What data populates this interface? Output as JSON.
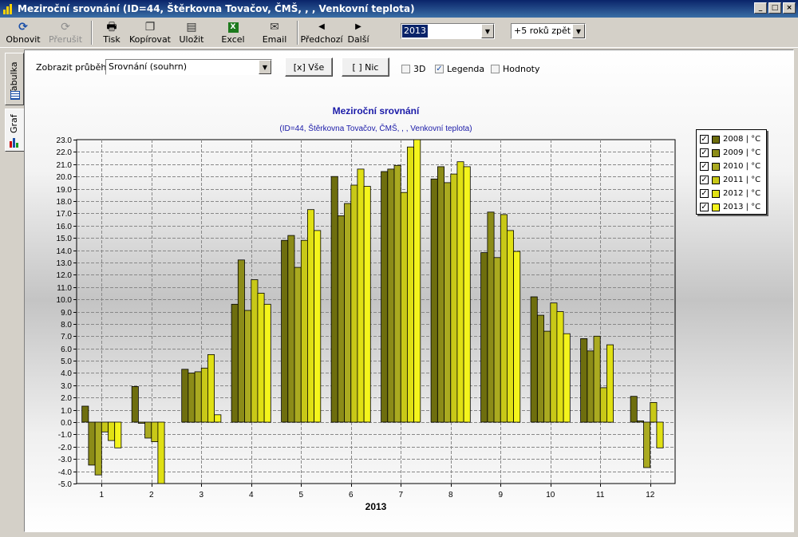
{
  "window": {
    "title": "Meziroční srovnání (ID=44, Štěrkovna Tovačov, ČMŠ, , , Venkovní teplota)"
  },
  "toolbar": {
    "refresh": "Obnovit",
    "stop": "Přerušit",
    "print": "Tisk",
    "copy": "Kopírovat",
    "save": "Uložit",
    "excel": "Excel",
    "email": "Email",
    "prev": "Předchozí",
    "next": "Další",
    "year_value": "2013",
    "range_value": "+5 roků zpět"
  },
  "tabs": {
    "table": "Tabulka",
    "chart": "Graf"
  },
  "controls": {
    "show_label": "Zobrazit průběh:",
    "show_value": "Srovnání (souhrn)",
    "all_button": "[x] Vše",
    "none_button": "[ ] Nic",
    "cb_3d": "3D",
    "cb_3d_checked": false,
    "cb_legend": "Legenda",
    "cb_legend_checked": true,
    "cb_values": "Hodnoty",
    "cb_values_checked": false
  },
  "chart_data": {
    "type": "bar",
    "title": "Meziroční srovnání",
    "subtitle": "(ID=44, Štěrkovna Tovačov, ČMŠ, , , Venkovní teplota)",
    "xlabel": "2013",
    "ylabel": "",
    "categories": [
      "1",
      "2",
      "3",
      "4",
      "5",
      "6",
      "7",
      "8",
      "9",
      "10",
      "11",
      "12"
    ],
    "ylim": [
      -5.0,
      23.0
    ],
    "ytick_step": 1.0,
    "grid": true,
    "legend_position": "right",
    "series": [
      {
        "name": "2008 | °C",
        "color": "#6e6e0e",
        "values": [
          1.3,
          2.9,
          4.3,
          9.6,
          14.8,
          20.0,
          20.4,
          19.8,
          13.8,
          10.2,
          6.8,
          2.1
        ]
      },
      {
        "name": "2009 | °C",
        "color": "#8c8c18",
        "values": [
          -3.5,
          -0.1,
          4.0,
          13.2,
          15.2,
          16.8,
          20.6,
          20.8,
          17.1,
          8.7,
          5.8,
          0.1
        ]
      },
      {
        "name": "2010 | °C",
        "color": "#aaaa20",
        "values": [
          -4.3,
          -1.3,
          4.1,
          9.1,
          12.6,
          17.8,
          20.9,
          19.5,
          13.4,
          7.4,
          7.0,
          -3.7
        ]
      },
      {
        "name": "2011 | °C",
        "color": "#c8c818",
        "values": [
          -0.8,
          -1.6,
          4.4,
          11.6,
          14.8,
          19.3,
          18.7,
          20.2,
          16.9,
          9.7,
          2.8,
          1.6
        ]
      },
      {
        "name": "2012 | °C",
        "color": "#e0e014",
        "values": [
          -1.5,
          -5.5,
          5.5,
          10.5,
          17.3,
          20.6,
          22.4,
          21.2,
          15.6,
          9.0,
          6.3,
          -2.1
        ]
      },
      {
        "name": "2013 | °C",
        "color": "#f4f41c",
        "values": [
          -2.1,
          null,
          0.6,
          9.6,
          15.6,
          19.2,
          23.0,
          20.8,
          13.9,
          7.2,
          null,
          null
        ]
      }
    ]
  }
}
